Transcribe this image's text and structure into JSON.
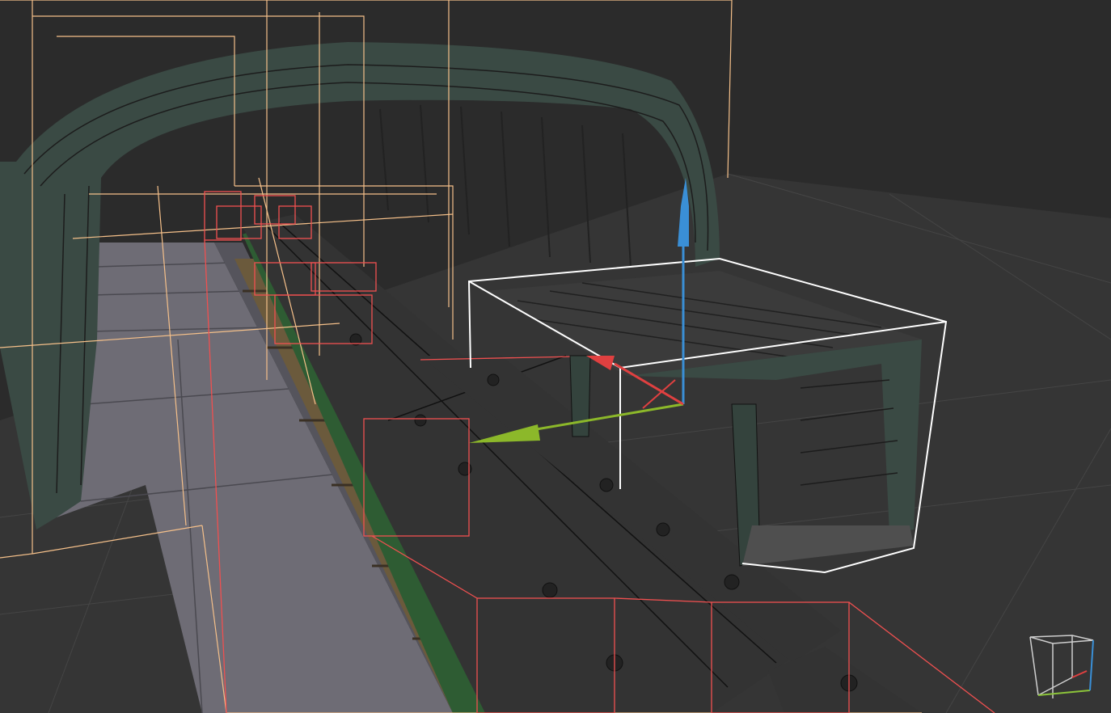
{
  "scene": {
    "background_color": "#2b2b2b",
    "floor_color": "#353535",
    "platform_color": "#6e6c75",
    "tunnel_color": "#3a4a44",
    "train_roof_color": "#333333",
    "train_body_color": "#2e5c33",
    "rail_color": "#6b5a3c",
    "bounds_default_color": "#f5c08a",
    "bounds_train_color": "#f05050",
    "selection_color": "#ffffff"
  },
  "gizmo": {
    "x_axis_color": "#e04040",
    "y_axis_color": "#8cb82a",
    "z_axis_color": "#3a8fd6"
  },
  "view_cube": {
    "x_color": "#e04040",
    "y_color": "#8cc43a",
    "z_color": "#3a8fd6",
    "edge_color": "#cfcfcf"
  }
}
